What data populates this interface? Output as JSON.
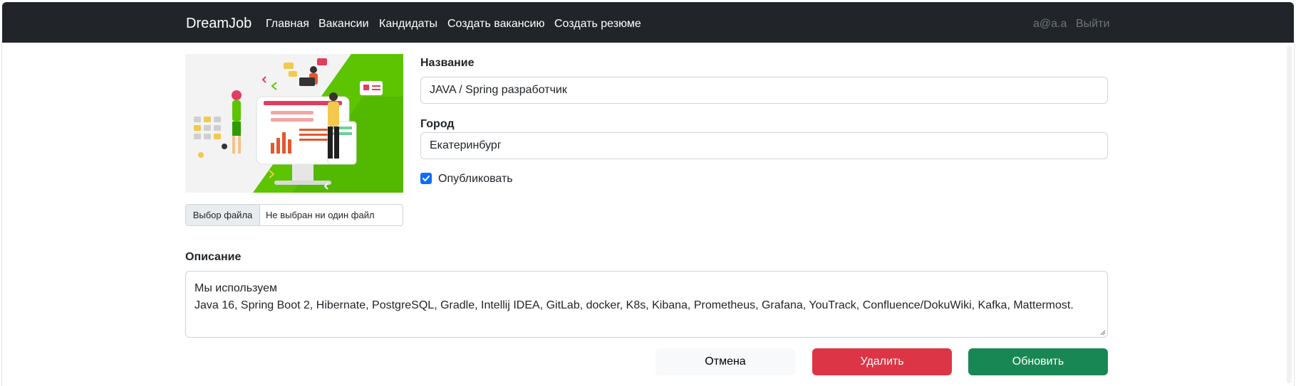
{
  "navbar": {
    "brand": "DreamJob",
    "links": [
      "Главная",
      "Вакансии",
      "Кандидаты",
      "Создать вакансию",
      "Создать резюме"
    ],
    "user_email": "a@a.a",
    "logout": "Выйти"
  },
  "photo": {
    "file_button": "Выбор файла",
    "file_status": "Не выбран ни один файл"
  },
  "form": {
    "title_label": "Название",
    "title_value": "JAVA / Spring разработчик",
    "city_label": "Город",
    "city_value": "Екатеринбург",
    "publish_label": "Опубликовать",
    "publish_checked": true,
    "description_label": "Описание",
    "description_lines": [
      "Мы используем",
      "Java 16, Spring Boot 2, Hibernate, PostgreSQL, Gradle, Intellij IDEA, GitLab, docker, K8s, Kibana, Prometheus, Grafana, YouTrack, Confluence/DokuWiki, Kafka, Mattermost."
    ]
  },
  "buttons": {
    "cancel": "Отмена",
    "delete": "Удалить",
    "update": "Обновить"
  },
  "colors": {
    "navbar_bg": "#212529",
    "primary": "#0d6efd",
    "danger": "#dc3545",
    "success": "#198754",
    "light": "#f8f9fa",
    "illustration_green": "#5cc400"
  }
}
